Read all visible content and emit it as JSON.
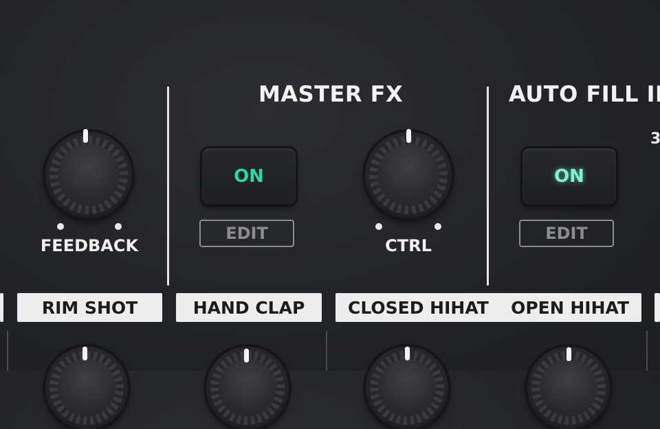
{
  "sections": {
    "master_fx": {
      "title": "MASTER FX"
    },
    "auto_fill": {
      "title": "AUTO FILL IN"
    },
    "partial_digit": "3"
  },
  "knobs": {
    "feedback": {
      "label": "FEEDBACK"
    },
    "ctrl": {
      "label": "CTRL"
    }
  },
  "buttons": {
    "master_fx_on": {
      "label": "ON",
      "color": "#2fd6a0"
    },
    "master_fx_edit": {
      "label": "EDIT"
    },
    "auto_fill_on": {
      "label": "ON",
      "color": "#7ff2d3"
    },
    "auto_fill_edit": {
      "label": "EDIT"
    }
  },
  "instrument_tags": {
    "rim_shot": "RIM SHOT",
    "hand_clap": "HAND CLAP",
    "closed_hihat": "CLOSED HIHAT",
    "open_hihat": "OPEN HIHAT"
  },
  "colors": {
    "panel": "#232427",
    "label_white": "#f0f0f0",
    "led_green": "#2fd6a0"
  }
}
